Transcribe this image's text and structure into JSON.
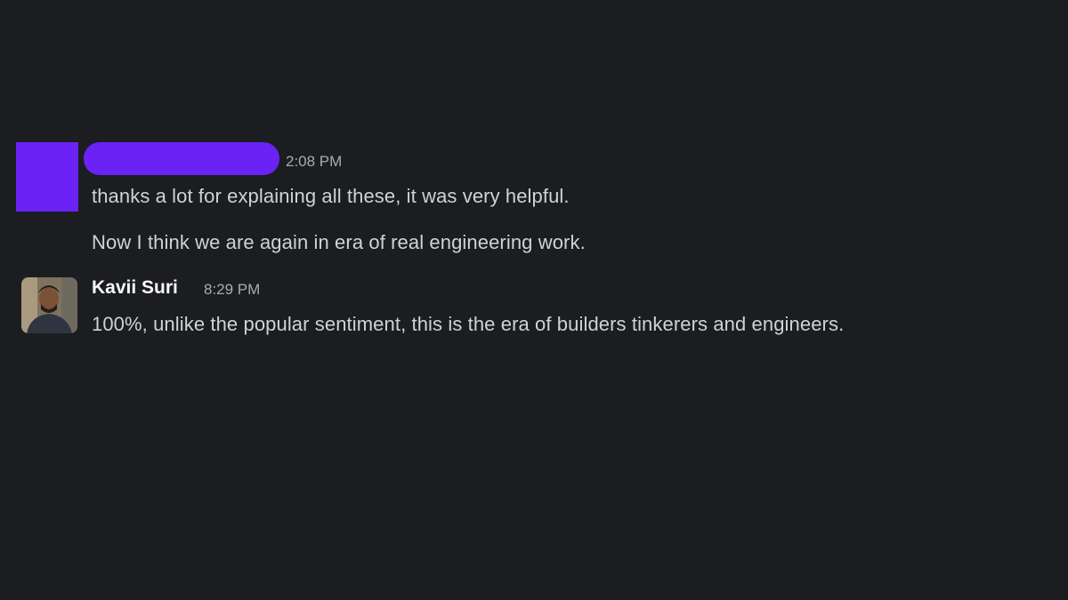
{
  "messages": [
    {
      "author": "",
      "timestamp": "2:08 PM",
      "lines": [
        "thanks a lot for explaining all these, it was very helpful.",
        "Now I think we are again in era of real engineering work."
      ]
    },
    {
      "author": "Kavii Suri",
      "timestamp": "8:29 PM",
      "lines": [
        "100%, unlike the popular sentiment, this is the era of builders tinkerers and engineers."
      ]
    }
  ],
  "colors": {
    "background": "#1b1d21",
    "redaction": "#6a22f5",
    "message_text": "#d1d2d3",
    "author_text": "#f8f8f8",
    "timestamp_text": "#ababad"
  }
}
